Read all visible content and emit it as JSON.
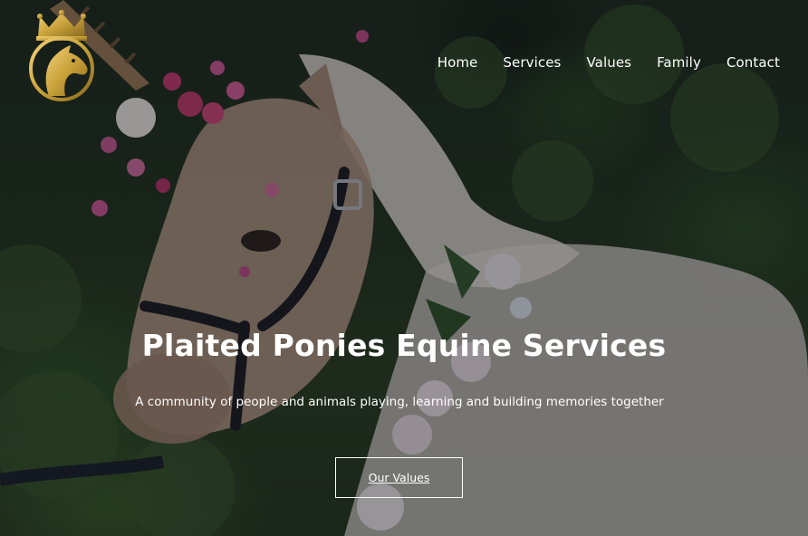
{
  "brand": {
    "logo_icon": "crowned-horse-head-icon",
    "gold": "#c9a23a",
    "gold_dark": "#8a6a1f"
  },
  "nav": {
    "items": [
      {
        "label": "Home"
      },
      {
        "label": "Services"
      },
      {
        "label": "Values"
      },
      {
        "label": "Family"
      },
      {
        "label": "Contact"
      }
    ]
  },
  "hero": {
    "title": "Plaited Ponies Equine Services",
    "subtitle": "A community of people and animals playing, learning and building memories together",
    "cta_label": "Our Values",
    "background_description_icon": "pony-with-flower-crown-photo",
    "overlay_color": "rgba(10, 12, 18, 0.38)",
    "text_color": "#ffffff"
  }
}
